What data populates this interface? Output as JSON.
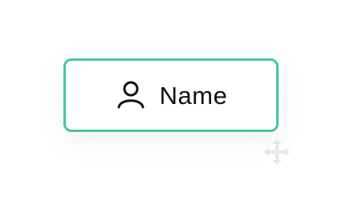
{
  "field": {
    "label": "Name",
    "icon": "person-icon",
    "border_color": "#46c79a"
  },
  "watermark": {
    "icon": "drag-handle-icon"
  }
}
